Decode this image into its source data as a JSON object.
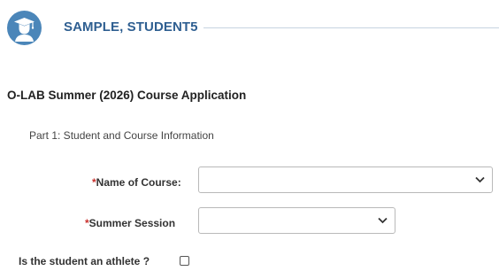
{
  "header": {
    "student_name": "SAMPLE, STUDENT5",
    "avatar_icon": "graduate-student-icon"
  },
  "form": {
    "title": "O-LAB Summer (2026) Course Application",
    "part_heading": "Part 1: Student and Course Information",
    "required_marker": "*",
    "fields": {
      "course": {
        "label": "Name of Course:",
        "value": ""
      },
      "session": {
        "label": "Summer Session",
        "value": ""
      },
      "athlete": {
        "label": "Is the student an athlete ?",
        "checked": false
      }
    }
  },
  "colors": {
    "brand": "#4b86b9",
    "title_text": "#2f5f91",
    "required": "#c9302c"
  },
  "icons": {
    "dropdown": "chevron-down-icon"
  }
}
